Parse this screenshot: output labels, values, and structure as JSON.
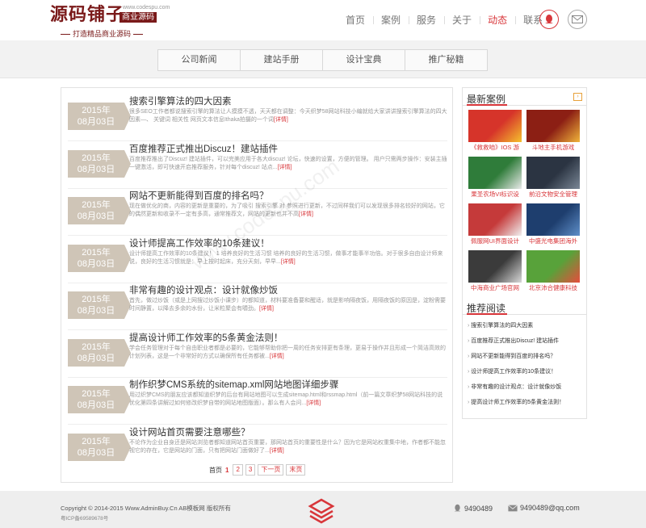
{
  "logo": {
    "main": "源码铺子",
    "tag": "商业源码",
    "url": "www.codespu.com",
    "slogan": "打造精品商业源码"
  },
  "nav": [
    "首页",
    "案例",
    "服务",
    "关于",
    "动态",
    "联系"
  ],
  "nav_active_index": 4,
  "subnav": [
    "公司新闻",
    "建站手册",
    "设计宝典",
    "推广秘籍"
  ],
  "articles": [
    {
      "year": "2015年",
      "date": "08月03日",
      "title": "搜索引擎算法的四大因素",
      "desc": "很多SEO工作者都说搜索引擎的算法让人摸摸不透，天天都在调整：今天织梦58网站科技小编就给大家讲讲搜索引擎算法的四大因素—、 关键词 相关性 网页文本信息Ithaka拍摄的一个词",
      "more": "[详情]"
    },
    {
      "year": "2015年",
      "date": "08月03日",
      "title": "百度推荐正式推出Discuz！建站插件",
      "desc": "百度推荐推出了Discuz! 建站插件，可以完美应用于各大discuz! 论坛，快速的设置，方便的管理。 用户只需两步操作：安装主插 一键激活，即可快速开启推荐服务，针对每个discuz! 站点...",
      "more": "[详情]"
    },
    {
      "year": "2015年",
      "date": "08月03日",
      "title": "网站不更新能得到百度的排名吗？",
      "desc": "现在做优化的商，内容的更新是重要的，为了吸引 搜索引擎 对 参照进行更新，不过同样我们可以发现很多排名较好的网站，它的偶然更新和收录不一定有多高，通常推荐文，网站的更新也并不高",
      "more": "[详情]"
    },
    {
      "year": "2015年",
      "date": "08月03日",
      "title": "设计师提高工作效率的10条建议！",
      "desc": "设计师提高工作效率的10条建议！ 1 培养良好的生活习惯 培养的良好的生活习惯，做事才能事半功倍。对于很多自由设计师来说，良好的生活习惯就是：早上按时起床，充分天刻，早早...",
      "more": "[详情]"
    },
    {
      "year": "2015年",
      "date": "08月03日",
      "title": "非常有趣的设计观点：设计就像炒饭",
      "desc": "首先，做过炒饭（或是上网搜过炒饭小课步）的都知道，材料要准备要和醒适，就是影响隔夜饭，用隔夜饭的原因是，淀粉需要时间静置，以降去多余的水份，让米粒聚会有嚼劲。",
      "more": "[详情]"
    },
    {
      "year": "2015年",
      "date": "08月03日",
      "title": "提高设计师工作效率的5条黄金法则！",
      "desc": "学会任务管理对于每个自由职业者都是必要的，它能够帮助你把一周的任务安排更有条理，更易于操作并且形成一个简洁高效的计划列表，这是一个非常好的方式以确保所有任务都被...",
      "more": "[详情]"
    },
    {
      "year": "2015年",
      "date": "08月03日",
      "title": "制作织梦CMS系统的sitemap.xml网站地图详细步骤",
      "desc": "用过织梦CMS的朋友应该都知道织梦的后台有网站地图可以生成sitemap.html和rssmap.html（前一篇文章织梦58网站科技的说优化第四条讲解过如何修改织梦自带的网站地图版面）。那么有人会问...",
      "more": "[详情]"
    },
    {
      "year": "2015年",
      "date": "08月03日",
      "title": "设计网站首页需要注意哪些？",
      "desc": "不论作为企业自身还是网站浏览者都知道网站首页重要，那网站首页的重要性是什么？因为它是网站权重集中地，作者都不能忽视它的存在，它是网站的门面，只有把网站门面做好了...",
      "more": "[详情]"
    }
  ],
  "pager": {
    "label": "首页",
    "current": "1",
    "pages": [
      "2",
      "3"
    ],
    "next": "下一页",
    "last": "末页"
  },
  "sidebar": {
    "cases_title": "最新案例",
    "cases": [
      {
        "caption": "《救救咱》IOS 游",
        "color": "#d6342a",
        "color2": "#f5c02e"
      },
      {
        "caption": "斗地主手机游戏",
        "color": "#8c1f14",
        "color2": "#f0b43a"
      },
      {
        "caption": "果圣农场VI标识设",
        "color": "#2f7c3a",
        "color2": "#eaeaea"
      },
      {
        "caption": "前沿文物安全管理",
        "color": "#2b3442",
        "color2": "#7a8796"
      },
      {
        "caption": "佩服网UI界面设计",
        "color": "#c53a3a",
        "color2": "#f0f0f0"
      },
      {
        "caption": "中盛光电集团海外",
        "color": "#1e3e6e",
        "color2": "#5f8fc9"
      },
      {
        "caption": "中海商业广场官网",
        "color": "#3b3b3b",
        "color2": "#d9d9d9"
      },
      {
        "caption": "北京沛合健康科技",
        "color": "#58a23a",
        "color2": "#e74c3c"
      }
    ],
    "rec_title": "推荐阅读",
    "recommendations": [
      "搜索引擎算法的四大因素",
      "百度推荐正式推出Discuz! 建站插件",
      "网站不更新能得到百度的排名吗？",
      "设计师提高工作效率的10条建议！",
      "非常有趣的设计观点：设计就像炒饭",
      "提高设计师工作效率的5条黄金法则！"
    ]
  },
  "footer": {
    "copyright": "Copyright © 2014-2015 Www.AdminBuy.Cn AB模板网 版权所有",
    "icp": "粤ICP备69589678号",
    "qq": "9490489",
    "email": "9490489@qq.com"
  },
  "watermark": "www.codespu.com",
  "colors": {
    "accent": "#d8363a",
    "date_badge": "#cfc5b7",
    "logo": "#7a1a1a"
  }
}
